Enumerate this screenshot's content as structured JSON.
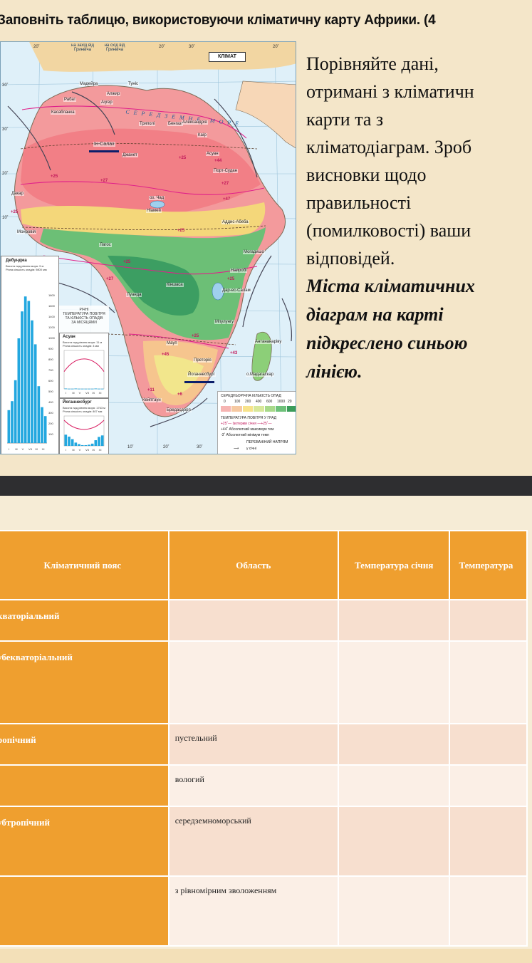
{
  "slide": {
    "title": "Заповніть таблицю, використовуючи кліматичну карту Африки. (4",
    "text_lines": [
      "Порівняйте дані,",
      "отримані з кліматичн",
      "карти та  з",
      "кліматодіаграм. Зроб",
      "висновки щодо",
      "правильності",
      "(помилковості) ваши",
      "відповідей."
    ],
    "italic_lines": [
      "Міста кліматичних",
      "діаграм на карті",
      "підкреслено синьою",
      "лінією."
    ]
  },
  "map": {
    "box_title": "КЛІМАТ",
    "top_labels": [
      "20˚",
      "на захід від Гринвіча",
      "на схід від Гринвіча",
      "20˚",
      "30˚",
      "20˚"
    ],
    "bottom_labels": [
      "10˚",
      "20˚",
      "30˚"
    ],
    "left_degrees": [
      "30˚",
      "30˚",
      "20˚",
      "10˚"
    ],
    "sea_label": "СЕРЕДЗЕМНЕ МОРЕ",
    "cities": [
      "Мадейра",
      "Рабат",
      "Касабланка",
      "Аҳгер",
      "Туніс",
      "Алжир",
      "Триполі",
      "Бенгазі",
      "Александрія",
      "Каїр",
      "Асуан",
      "Ін-Салах",
      "Джанет",
      "Порт-Судан",
      "Дакар",
      "оз. Чад",
      "Ніамей",
      "Аддис-Абеба",
      "Монровія",
      "Могадишо",
      "Найробі",
      "Дар-ес-Салам",
      "Кіншаса",
      "Луанда",
      "Мпулунгу",
      "Мауп",
      "Антананаріву",
      "Преторія",
      "Йоганнесбург",
      "Кейптаун",
      "Бредасдорп",
      "о.Мадагаскар",
      "Лагос",
      "Дебунджа"
    ],
    "underlined_cities": [
      "Ін-Салах",
      "Дебунджа",
      "Йоганнесбург"
    ],
    "temps": [
      "+25",
      "+27",
      "+25",
      "+27",
      "+25",
      "+44",
      "+47",
      "+25",
      "+25",
      "+27",
      "+25",
      "+43",
      "+25",
      "+45",
      "+11",
      "+6"
    ]
  },
  "diagrams": {
    "main": {
      "city": "Дебунджа",
      "line1": "Висота над рівнем моря: 9 м",
      "line2": "Річна кількість опадів: 9800 мм",
      "scale": [
        "1800",
        "1600",
        "1400",
        "1200",
        "1000",
        "900",
        "800",
        "700",
        "600",
        "500",
        "400",
        "300",
        "200",
        "100"
      ],
      "months": [
        "I",
        "III",
        "V",
        "VII",
        "IX",
        "XI"
      ],
      "precip": [
        0.22,
        0.28,
        0.42,
        0.7,
        0.88,
        0.98,
        0.95,
        0.82,
        0.66,
        0.38,
        0.24,
        0.18
      ]
    },
    "caption": [
      "РІЧНІ",
      "ТЕМПЕРАТУРА ПОВІТРЯ",
      "ТА КІЛЬКІСТЬ ОПАДІВ",
      "ЗА МІСЯЦЯМИ"
    ],
    "aswan": {
      "city": "Асуан",
      "line1": "Висота над рівнем моря: 11 м",
      "line2": "Річна кількість опадів: 3 мм",
      "months": [
        "I",
        "III",
        "V",
        "VII",
        "IX",
        "XI"
      ],
      "precip": [
        0.02,
        0.01,
        0.01,
        0.02,
        0.01,
        0.01,
        0.01,
        0.01,
        0.01,
        0.02,
        0.01,
        0.01
      ]
    },
    "joburg": {
      "city": "Йоганнесбург",
      "line1": "Висота над рівнем моря: 1763 м",
      "line2": "Річна кількість опадів: 807 мм",
      "months": [
        "I",
        "III",
        "V",
        "VII",
        "IX",
        "XI"
      ],
      "precip": [
        0.75,
        0.62,
        0.45,
        0.22,
        0.12,
        0.05,
        0.05,
        0.08,
        0.15,
        0.38,
        0.6,
        0.7
      ]
    }
  },
  "legend": {
    "title": "СЕРЕДНЬОРІЧНА КІЛЬКІСТЬ ОПАД",
    "scale": [
      "0",
      "100",
      "200",
      "400",
      "600",
      "1000",
      "20"
    ],
    "colors": [
      "#f6b4b2",
      "#f6c9a2",
      "#f7e38b",
      "#d8e89a",
      "#a8d98a",
      "#6ec17a",
      "#3a9c5a"
    ],
    "temp_title": "ТЕМПЕРАТУРА ПОВІТРЯ У ГРАД",
    "item1": "+25˚— Ізотерми січня —+25˚—",
    "item2": "+44˚  Абсолютний максимум тем",
    "item3": "-3˚  Абсолютний мінімум темп",
    "wind_title": "ПЕРЕВАЖНИЙ НАПРЯМ",
    "wind_item": "у січні"
  },
  "table": {
    "headers": [
      "Кліматичний пояс",
      "Область",
      "Температура січня",
      "Температура"
    ],
    "rows": [
      {
        "belt": "кваторіальний",
        "area": "",
        "style": "a"
      },
      {
        "belt": "убекваторіальний",
        "area": "",
        "style": "b"
      },
      {
        "belt": "ропічний",
        "area": "пустельний",
        "style": "a"
      },
      {
        "belt": "",
        "area": "вологий",
        "style": "b"
      },
      {
        "belt": "убтропічний",
        "area": "середземноморський",
        "style": "a"
      },
      {
        "belt": "",
        "area": "з рівномірним зволоженням",
        "style": "b"
      }
    ]
  },
  "colors": {
    "header_orange": "#ef9f2f",
    "row_light": "#f7dfcf",
    "row_lighter": "#fbefe6",
    "band_dark": "#2e2e30"
  }
}
